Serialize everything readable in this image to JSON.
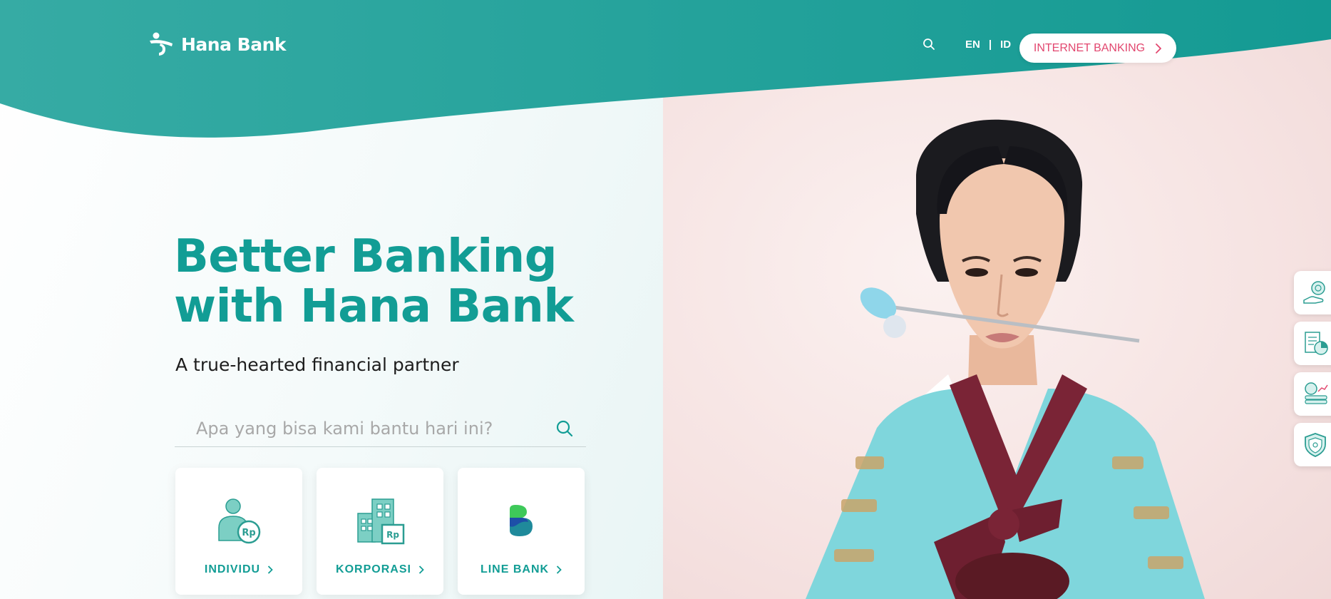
{
  "header": {
    "logo_text": "Hana Bank",
    "lang_en": "EN",
    "lang_sep": "|",
    "lang_id": "ID",
    "internet_banking_label": "INTERNET BANKING"
  },
  "hero": {
    "title_line1": "Better Banking",
    "title_line2": "with Hana Bank",
    "subtitle": "A true-hearted financial partner"
  },
  "search": {
    "placeholder": "Apa yang bisa kami bantu hari ini?",
    "value": ""
  },
  "cards": [
    {
      "label": "INDIVIDU",
      "icon": "person-rupiah-icon"
    },
    {
      "label": "KORPORASI",
      "icon": "building-rupiah-icon"
    },
    {
      "label": "LINE BANK",
      "icon": "line-bank-logo-icon"
    }
  ],
  "quick_links": [
    {
      "icon": "hand-coin-icon"
    },
    {
      "icon": "document-chart-icon"
    },
    {
      "icon": "coins-growth-icon"
    },
    {
      "icon": "shield-icon"
    }
  ],
  "colors": {
    "brand_teal": "#129d95",
    "header_teal": "#1fa39c",
    "accent_pink": "#e2476f"
  }
}
